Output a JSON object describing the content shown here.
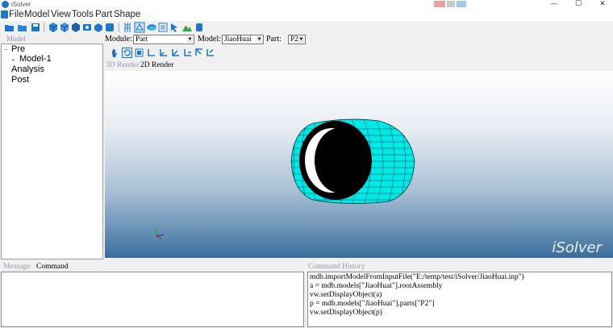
{
  "window": {
    "title": "iSolver",
    "controls": {
      "minimize": "—",
      "maximize": "☐",
      "close": "✕"
    },
    "accent_colors": [
      "#e8a0a0",
      "#c8c8c8",
      "#a0c8e8"
    ]
  },
  "menu": {
    "items": [
      "File",
      "Model",
      "View",
      "Tools",
      "Part",
      "Shape"
    ]
  },
  "toolbar": {
    "icons": [
      "open-folder-icon",
      "folder-icon",
      "save-icon",
      "cube-blue-icon",
      "cube-multi-icon",
      "cube-shade-icon",
      "part-icon",
      "assembly-icon",
      "model-tree-icon",
      "mesh-icon",
      "layers-icon",
      "property-icon",
      "material-icon",
      "loads-icon",
      "terrain-icon",
      "cylinder-icon"
    ]
  },
  "model_panel": {
    "header": "Model",
    "tree": [
      {
        "label": "Pre",
        "toggle": "−"
      },
      {
        "label": "Model-1",
        "toggle": "•"
      },
      {
        "label": "Analysis",
        "toggle": ""
      },
      {
        "label": "Post",
        "toggle": ""
      }
    ]
  },
  "module_bar": {
    "module_label": "Module:",
    "module_value": "Part",
    "model_label": "Model:",
    "model_value": "JiaoHuai",
    "part_label": "Part:",
    "part_value": "P2"
  },
  "view_tools": {
    "icons": [
      "pan-hand-icon",
      "rotate-icon",
      "zoom-fit-icon",
      "view-front-icon",
      "view-back-icon",
      "view-left-icon",
      "view-right-icon",
      "view-top-icon",
      "view-iso-icon"
    ]
  },
  "render_tabs": [
    "3D Render",
    "2D Render"
  ],
  "viewport": {
    "watermark": "iSolver",
    "mesh_color": "#00e8e8"
  },
  "bottom_left": {
    "tabs": [
      "Message",
      "Command"
    ]
  },
  "command_history": {
    "header": "Command History",
    "lines": [
      "mdb.importModelFromInputFile(\"E:/temp/test/iSolver/JiaoHuai.inp\")",
      "a = mdb.models[\"JiaoHuai\"].rootAssembly",
      "vw.setDisplayObject(a)",
      "p = mdb.models[\"JiaoHuai\"].parts[\"P2\"]",
      "vw.setDisplayObject(p)"
    ]
  }
}
